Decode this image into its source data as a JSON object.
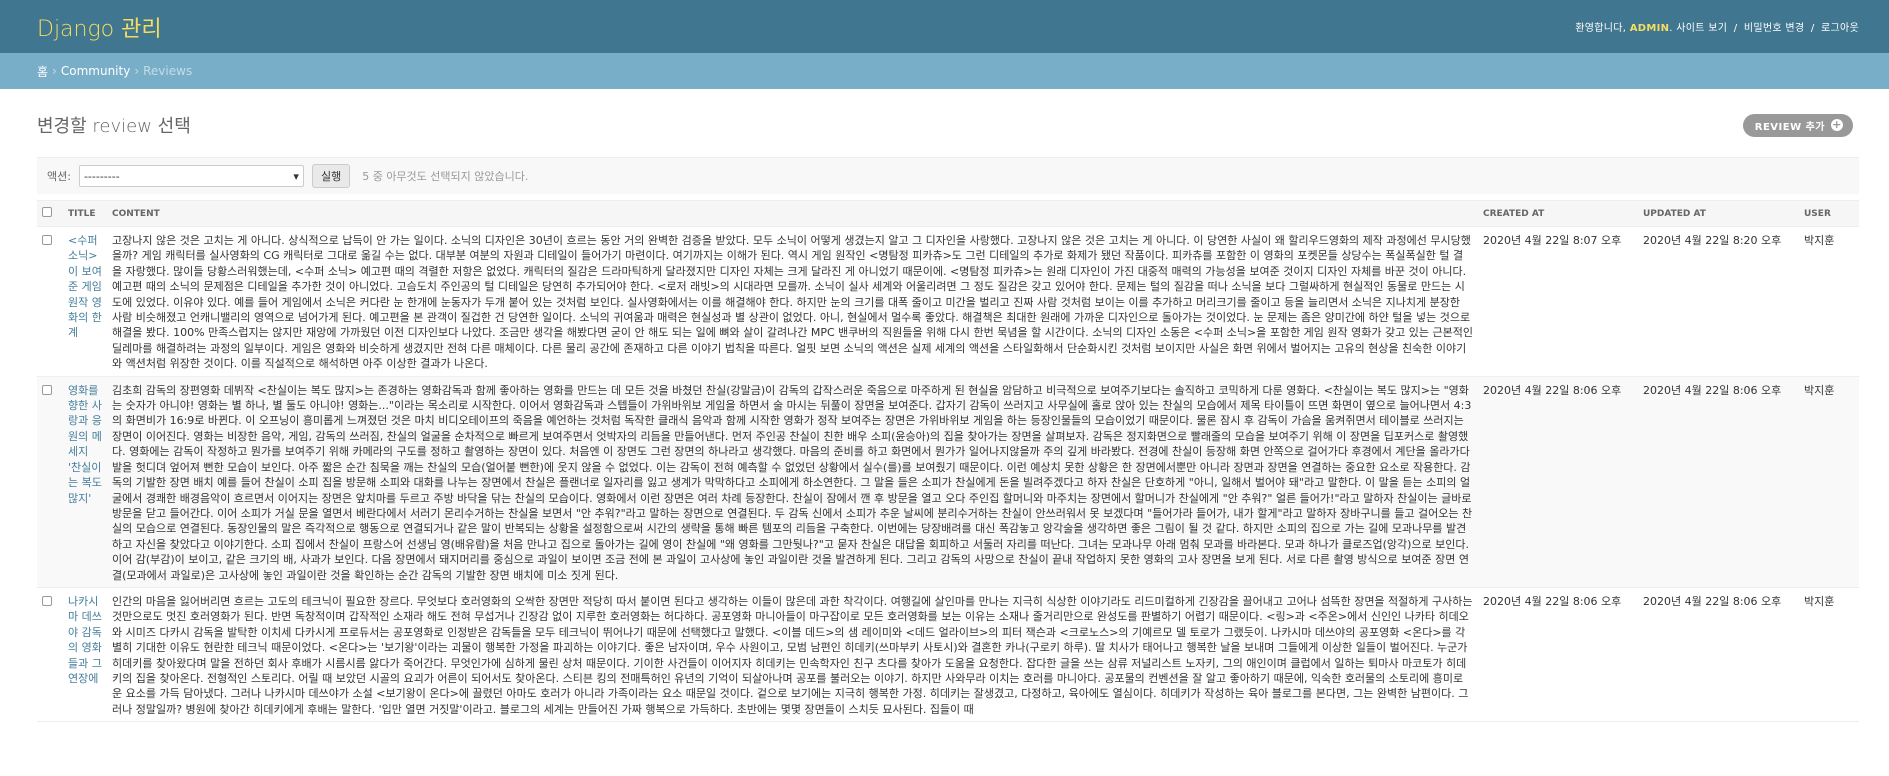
{
  "header": {
    "branding": "Django 관리",
    "welcome": "환영합니다,",
    "username": "ADMIN",
    "links": [
      "사이트 보기",
      "비밀번호 변경",
      "로그아웃"
    ]
  },
  "breadcrumbs": {
    "home": "홈",
    "app": "Community",
    "current": "Reviews"
  },
  "page": {
    "title": "변경할 review 선택",
    "add_label": "REVIEW 추가"
  },
  "actions": {
    "label": "액션:",
    "selected": "---------",
    "go": "실행",
    "counter": "5 중 아무것도 선택되지 않았습니다."
  },
  "table": {
    "columns": [
      "TITLE",
      "CONTENT",
      "CREATED AT",
      "UPDATED AT",
      "USER"
    ],
    "rows": [
      {
        "title": "<수퍼 소닉> 이 보여준 게임 원작 영화의 한계",
        "content": "고장나지 않은 것은 고치는 게 아니다. 상식적으로 납득이 안 가는 일이다. 소닉의 디자인은 30년이 흐르는 동안 거의 완벽한 검증을 받았다. 모두 소닉이 어떻게 생겼는지 알고 그 디자인을 사랑했다. 고장나지 않은 것은 고치는 게 아니다. 이 당연한 사실이 왜 할리우드영화의 제작 과정에선 무시당했을까? 게임 캐릭터를 실사영화의 CG 캐릭터로 그대로 옮길 수는 없다. 대부분 여분의 자원과 디테일이 들어가기 마련이다. 여기까지는 이해가 된다. 역시 게임 원작인 <명탐정 피카츄>도 그런 디테일의 추가로 화제가 됐던 작품이다. 피카츄를 포함한 이 영화의 포켓몬들 상당수는 폭실폭실한 털 결을 자랑했다. 많이들 당황스러워했는데, <수퍼 소닉> 예고편 때의 격렬한 저항은 없었다. 캐릭터의 질감은 드라마틱하게 달라졌지만 디자인 자체는 크게 달라진 게 아니었기 때문이에. <명탐정 피카츄>는 원래 디자인이 가진 대중적 매력의 가능성을 보여준 것이지 디자인 자체를 바꾼 것이 아니다. 예고편 때의 소닉의 문제점은 디테일을 추가한 것이 아니었다. 고슴도치 주인공의 털 디테일은 당연히 추가되어야 한다. <로저 래빗>의 시대라면 모를까. 소닉이 실사 세계와 어울리려면 그 정도 질감은 갖고 있어야 한다. 문제는 털의 질감을 떠나 소닉을 보다 그럴싸하게 현실적인 동물로 만드는 시도에 있었다. 이유야 있다. 예를 들어 게임에서 소닉은 커다란 눈 한개에 눈동자가 두개 붙어 있는 것처럼 보인다. 실사영화에서는 이를 해결해야 한다. 하지만 눈의 크기를 대폭 줄이고 미간을 벌리고 진짜 사람 것처럼 보이는 이를 추가하고 머리크기를 줄이고 등을 늘리면서 소닉은 지나치게 분장한 사람 비슷해졌고 언캐니밸리의 영역으로 넘어가게 된다. 예고편을 본 관객이 질겁한 건 당연한 일이다. 소닉의 귀여움과 매력은 현실성과 별 상관이 없었다. 아니, 현실에서 멀수록 좋았다. 해결책은 최대한 원래에 가까운 디자인으로 돌아가는 것이었다. 눈 문제는 좀은 양미간에 하얀 털을 넣는 것으로 해결을 봤다. 100% 만족스럽지는 않지만 재앙에 가까웠던 이전 디자인보다 나았다. 조금만 생각을 해봤다면 굳이 안 해도 되는 일에 뼈와 살이 갈려나간 MPC 밴쿠버의 직원들을 위해 다시 한번 묵념을 할 시간이다. 소닉의 디자인 소동은 <수퍼 소닉>을 포함한 게임 원작 영화가 갖고 있는 근본적인 딜레마를 해결하려는 과정의 일부이다. 게임은 영화와 비슷하게 생겼지만 전혀 다른 매체이다. 다른 물리 공간에 존재하고 다른 이야기 법칙을 따른다. 얼핏 보면 소닉의 액션은 실제 세계의 액션을 스타일화해서 단순화시킨 것처럼 보이지만 사실은 화면 위에서 벌어지는 고유의 현상을 친숙한 이야기와 액션처럼 위장한 것이다. 이를 직설적으로 해석하면 아주 이상한 결과가 나온다.",
        "created": "2020년 4월 22일 8:07 오후",
        "updated": "2020년 4월 22일 8:20 오후",
        "user": "박지훈"
      },
      {
        "title": "영화를 향한 사랑과 응원의 메세지 '찬실이는 복도 많지'",
        "content": "김초희 감독의 장편영화 데뷔작 <찬실이는 복도 많지>는 존경하는 영화감독과 함께 좋아하는 영화를 만드는 데 모든 것을 바쳤던 찬실(강말금)이 감독의 갑작스러운 죽음으로 마주하게 된 현실을 암담하고 비극적으로 보여주기보다는 솔직하고 코믹하게 다룬 영화다. <찬실이는 복도 많지>는 \"영화는 숫자가 아니야! 영화는 별 하나, 별 둘도 아니야! 영화는...\"이라는 목소리로 시작한다. 이어서 영화감독과 스텝들이 가위바위보 게임을 하면서 술 마시는 뒤풀이 장면을 보여준다. 갑자기 감독이 쓰러지고 사무실에 홀로 앉아 있는 찬실의 모습에서 제목 타이틀이 뜨면 화면이 옆으로 늘어나면서 4:3의 화면비가 16:9로 바뀐다. 이 오프닝이 흥미롭게 느껴졌던 것은 마치 비디오테이프의 죽음을 예언하는 것처럼 독작한 클래식 음악과 함께 시작한 영화가 정작 보여주는 장면은 가위바위보 게임을 하는 등장인물들의 모습이었기 때문이다. 물론 잠시 후 감독이 가슴을 움켜쥐면서 테이블로 쓰러지는 장면이 이어진다. 영화는 비장한 음악, 게임, 감독의 쓰러짐, 찬실의 얼굴을 순차적으로 빠르게 보여주면서 엇박자의 리듬을 만들어낸다. 먼저 주인공 찬실이 친한 배우 소피(윤승아)의 집을 찾아가는 장면을 살펴보자. 감독은 정지화면으로 빨래줄의 모습을 보여주기 위해 이 장면을 딥포커스로 촬영했다. 영화에는 감독이 작정하고 뭔가를 보여주기 위해 카메라의 구도를 정하고 촬영하는 장면이 있다. 처음엔 이 장면도 그런 장면의 하나라고 생각했다. 마음의 준비를 하고 화면에서 뭔가가 일어나지않을까 주의 깊게 바라봤다. 전경에 찬실이 등장해 화면 안쪽으로 걸어가다 후경에서 계단을 올라가다 발을 헛디뎌 엎어져 뻔한 모습이 보인다. 아주 짧은 순간 침묵을 깨는 찬실의 모습(얼어붙 뻔한)에 웃지 않을 수 없었다. 이는 감독이 전혀 예측할 수 없었던 상황에서 실수(를)를 보여줬기 때문이다. 이런 예상치 못한 상황은 한 장면에서뿐만 아니라 장면과 장면을 연결하는 중요한 요소로 작용한다. 감독의 기발한 장면 배치 예를 들어 찬실이 소피 집을 방문해 소피와 대화를 나누는 장면에서 찬실은 플랜너로 일자리를 잃고 생계가 막막하다고 소피에게 하소연한다. 그 말을 들은 소피가 찬실에게 돈을 빌려주겠다고 하자 찬실은 단호하게 \"아니, 일해서 벌어야 돼\"라고 말한다. 이 말을 듣는 소피의 얼굴에서 경쾌한 배경음악이 흐르면서 이어지는 장면은 앞치마를 두르고 주방 바닥을 닦는 찬실의 모습이다. 영화에서 이런 장면은 여러 차례 등장한다. 찬실이 잠에서 깬 후 방문을 열고 오다 주인집 할머니와 마주치는 장면에서 할머니가 찬실에게 \"안 추워?\" 얼른 들어가!\"라고 말하자 찬실이는 글바로 방문을 닫고 들어간다. 이어 소피가 거실 문을 열면서 베란다에서 서러기 몬리수거하는 찬실을 보면서 \"안 추워?\"라고 말하는 장면으로 연결된다. 두 감독 신에서 소피가 추운 날씨에 분리수거하는 찬실이 안쓰러워서 못 보겠다며 \"들어가라 들어가, 내가 할게\"라고 말하자 장바구니를 들고 걸어오는 찬실의 모습으로 연결된다. 동장인물의 말은 즉각적으로 행동으로 연결되거나 같은 말이 반복되는 상황을 설정함으로써 시간의 생략을 통해 빠른 템포의 리듬을 구축한다. 이번에는 당장배려를 대신 폭감놓고 앙각술을 생각하면 좋은 그림이 될 것 같다. 하지만 소피의 집으로 가는 길에 모과나무를 발견하고 자신을 찾았다고 이야기한다. 소피 집에서 찬실이 프랑스어 선생님 영(배유람)을 처음 만나고 집으로 돌아가는 길에 영이 찬실에 \"왜 영화를 그만둿나?\"고 묻자 찬실은 대답을 회피하고 서둘러 자리를 떠난다. 그녀는 모과나무 아래 멈춰 모과를 바라본다. 모과 하나가 클로즈업(앙각)으로 보인다. 이어 감(부감)이 보이고, 같은 크기의 배, 사과가 보인다. 다음 장면에서 돼지머리를 중심으로 과일이 보이면 조금 전에 본 과일이 고사상에 놓인 과일이란 것을 발견하게 된다. 그리고 감독의 사망으로 찬실이 끝내 작업하지 못한 영화의 고사 장면을 보게 된다. 서로 다른 촬영 방식으로 보여준 장면 연결(모과에서 과일로)은 고사상에 놓인 과일이란 것을 확인하는 순간 감독의 기발한 장면 배치에 미소 짓게 된다.",
        "created": "2020년 4월 22일 8:06 오후",
        "updated": "2020년 4월 22일 8:06 오후",
        "user": "박지훈"
      },
      {
        "title": "나카시마 데쓰야 감독의 영화들과 그 연장에",
        "content": "인간의 마음을 잃어버리면 흐르는 고도의 테크닉이 필요한 장르다. 무엇보다 호러영화의 오싹한 장면만 적당히 따서 붙이면 된다고 생각하는 이들이 많은데 과한 착각이다. 여행길에 살인마를 만나는 지극히 식상한 이야기라도 리드미컬하게 긴장감을 끌어내고 고어나 섬뜩한 장면을 적절하게 구사하는 것만으로도 멋진 호러영화가 된다. 반면 독창적이며 갑작적인 소재라 해도 전혀 무섭거나 긴장감 없이 지루한 호러영화는 허다하다. 공포영화 마니아들이 마구잡이로 모든 호러영화를 보는 이유는 소재나 줄거리만으로 완성도를 판별하기 어렵기 때문이다. <링>과 <주온>에서 신인인 나카타 히데오와 시미즈 다카시 감독을 발탁한 이치세 다카시게 프로듀서는 공포영화로 인정받은 감독들을 모두 테크닉이 뛰어나기 때문에 선택했다고 말했다. <이블 데드>의 샘 레이미와 <데드 얼라이브>의 피터 잭슨과 <크로노스>의 기예르모 델 토로가 그랬듯이. 나카시마 데쓰야의 공포영화 <온다>를 각별히 기대한 이유도 현란한 테크닉 때문이었다. <온다>는 '보기왕'이라는 괴물이 행복한 가정을 파괴하는 이야기다. 좋은 남자이며, 우수 사원이고, 모범 남편인 히데키(쓰마부키 사토시)와 결혼한 카나(구로키 하루). 딸 치사가 태어나고 행복한 날을 보내며 그들에게 이상한 일들이 벌어진다. 누군가 히데키를 찾아왔다며 말을 전하던 회사 후배가 시름시름 앓다가 죽어간다. 무엇인가에 심하게 물린 상처 때문이다. 기이한 사건들이 이어지자 히데키는 민속학자인 친구 츠다를 찾아가 도움을 요청한다. 잡다한 글을 쓰는 삼류 저널리스트 노자키, 그의 애인이며 클럽에서 일하는 퇴마사 마코토가 히데키의 집을 찾아온다. 전형적인 스토리다. 어릴 때 보았던 시골의 요괴가 어른이 되어서도 찾아온다. 스티븐 킹의 전매특허인 유년의 기억이 되살아나며 공포를 불러오는 이야기. 하지만 사와무라 이치는 호러를 마니아다. 공포물의 컨벤션을 잘 알고 좋아하기 때문에, 익숙한 호러물의 소토리에 흥미로운 요소를 가득 담아냈다. 그러나 나카시마 데쓰야가 소설 <보기왕이 온다>에 끌렸던 아마도 호러가 아니라 가족이라는 요소 때문일 것이다. 겉으로 보기에는 지극히 행복한 가정. 히데키는 잘생겼고, 다정하고, 육아에도 열심이다. 히데키가 작성하는 육아 블로그를 본다면, 그는 완벽한 남편이다. 그러나 정말일까? 병원에 찾아간 히데키에게 후배는 말한다. '입만 열면 거짓말'이라고. 블로그의 세계는 만들어진 가짜 행복으로 가득하다. 초반에는 몇몇 장면들이 스치듯 묘사된다. 집들이 때",
        "created": "2020년 4월 22일 8:06 오후",
        "updated": "2020년 4월 22일 8:06 오후",
        "user": "박지훈"
      }
    ]
  }
}
